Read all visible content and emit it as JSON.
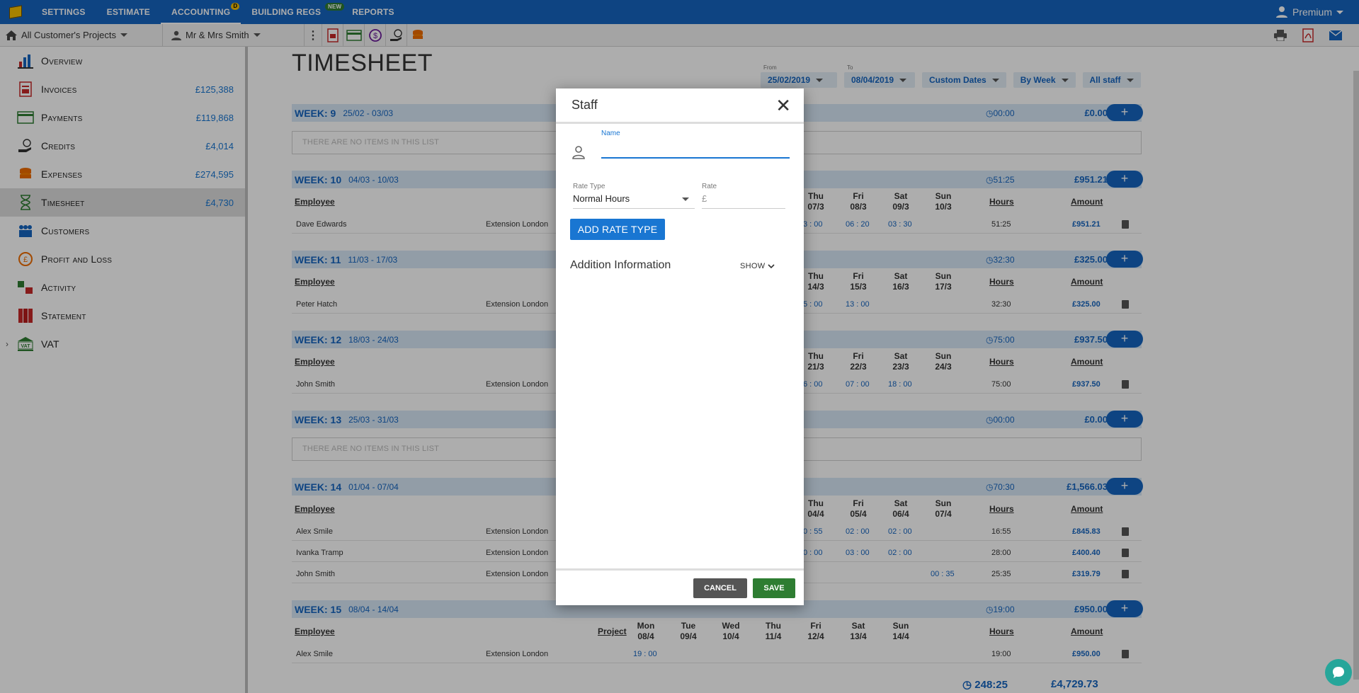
{
  "nav": {
    "items": [
      {
        "label": "SETTINGS"
      },
      {
        "label": "ESTIMATE"
      },
      {
        "label": "ACCOUNTING",
        "badge": "D",
        "active": true
      },
      {
        "label": "BUILDING REGS",
        "badge": "NEW"
      },
      {
        "label": "REPORTS"
      }
    ],
    "account": "Premium"
  },
  "subbar": {
    "project": "All Customer's Projects",
    "client": "Mr & Mrs Smith"
  },
  "sidebar": {
    "items": [
      {
        "label": "Overview",
        "amount": ""
      },
      {
        "label": "Invoices",
        "amount": "£125,388"
      },
      {
        "label": "Payments",
        "amount": "£119,868"
      },
      {
        "label": "Credits",
        "amount": "£4,014"
      },
      {
        "label": "Expenses",
        "amount": "£274,595"
      },
      {
        "label": "Timesheet",
        "amount": "£4,730"
      },
      {
        "label": "Customers",
        "amount": ""
      },
      {
        "label": "Profit and Loss",
        "amount": ""
      },
      {
        "label": "Activity",
        "amount": ""
      },
      {
        "label": "Statement",
        "amount": ""
      },
      {
        "label": "VAT",
        "amount": ""
      }
    ]
  },
  "main": {
    "title": "TIMESHEET",
    "filters": {
      "from_label": "From",
      "from_value": "25/02/2019",
      "to_label": "To",
      "to_value": "08/04/2019",
      "range": "Custom Dates",
      "group": "By Week",
      "staff": "All staff"
    },
    "headers": {
      "employee": "Employee",
      "project": "Project",
      "hours": "Hours",
      "amount": "Amount"
    },
    "empty_text": "THERE ARE NO ITEMS IN THIS LIST",
    "weeks": [
      {
        "title": "WEEK: 9",
        "range": "25/02 - 03/03",
        "hours": "00:00",
        "amount": "£0.00"
      },
      {
        "title": "WEEK: 10",
        "range": "04/03 - 10/03",
        "hours": "51:25",
        "amount": "£951.21",
        "days": [
          "Thu 07/3",
          "Fri 08/3",
          "Sat 09/3",
          "Sun 10/3"
        ],
        "rows": [
          {
            "employee": "Dave Edwards",
            "project": "Extension London",
            "thu": "3 : 00",
            "fri": "06 : 20",
            "sat": "03 : 30",
            "sun": "",
            "hours": "51:25",
            "amount": "£951.21"
          }
        ]
      },
      {
        "title": "WEEK: 11",
        "range": "11/03 - 17/03",
        "hours": "32:30",
        "amount": "£325.00",
        "days": [
          "Thu 14/3",
          "Fri 15/3",
          "Sat 16/3",
          "Sun 17/3"
        ],
        "rows": [
          {
            "employee": "Peter Hatch",
            "project": "Extension London",
            "thu": "5 : 00",
            "fri": "13 : 00",
            "sat": "",
            "sun": "",
            "hours": "32:30",
            "amount": "£325.00"
          }
        ]
      },
      {
        "title": "WEEK: 12",
        "range": "18/03 - 24/03",
        "hours": "75:00",
        "amount": "£937.50",
        "days": [
          "Thu 21/3",
          "Fri 22/3",
          "Sat 23/3",
          "Sun 24/3"
        ],
        "rows": [
          {
            "employee": "John Smith",
            "project": "Extension London",
            "thu": "6 : 00",
            "fri": "07 : 00",
            "sat": "18 : 00",
            "sun": "",
            "hours": "75:00",
            "amount": "£937.50"
          }
        ]
      },
      {
        "title": "WEEK: 13",
        "range": "25/03 - 31/03",
        "hours": "00:00",
        "amount": "£0.00"
      },
      {
        "title": "WEEK: 14",
        "range": "01/04 - 07/04",
        "hours": "70:30",
        "amount": "£1,566.03",
        "days": [
          "Thu 04/4",
          "Fri 05/4",
          "Sat 06/4",
          "Sun 07/4"
        ],
        "rows": [
          {
            "employee": "Alex Smile",
            "project": "Extension London",
            "thu": "0 : 55",
            "fri": "02 : 00",
            "sat": "02 : 00",
            "sun": "",
            "hours": "16:55",
            "amount": "£845.83"
          },
          {
            "employee": "Ivanka Tramp",
            "project": "Extension London",
            "thu": "0 : 00",
            "fri": "03 : 00",
            "sat": "02 : 00",
            "sun": "",
            "hours": "28:00",
            "amount": "£400.40"
          },
          {
            "employee": "John Smith",
            "project": "Extension London",
            "thu": "",
            "fri": "",
            "sat": "",
            "sun": "00 : 35",
            "hours": "25:35",
            "amount": "£319.79"
          }
        ]
      },
      {
        "title": "WEEK: 15",
        "range": "08/04 - 14/04",
        "hours": "19:00",
        "amount": "£950.00",
        "days": [
          "Mon 08/4",
          "Tue 09/4",
          "Wed 10/4",
          "Thu 11/4",
          "Fri 12/4",
          "Sat 13/4",
          "Sun 14/4"
        ],
        "rows": [
          {
            "employee": "Alex Smile",
            "project": "Extension London",
            "mon": "19 : 00",
            "hours": "19:00",
            "amount": "£950.00"
          }
        ]
      }
    ],
    "total_hours": "248:25",
    "total_amount": "£4,729.73"
  },
  "dialog": {
    "title": "Staff",
    "name_label": "Name",
    "name_value": "",
    "rate_type_label": "Rate Type",
    "rate_type_value": "Normal Hours",
    "rate_label": "Rate",
    "rate_placeholder": "£",
    "add_rate_label": "ADD RATE TYPE",
    "addition_info_label": "Addition Information",
    "show_label": "SHOW",
    "cancel_label": "CANCEL",
    "save_label": "SAVE"
  },
  "colors": {
    "primary": "#1565c0",
    "week_header": "#d7e8f7",
    "save": "#2e7d32",
    "cancel": "#555555"
  }
}
